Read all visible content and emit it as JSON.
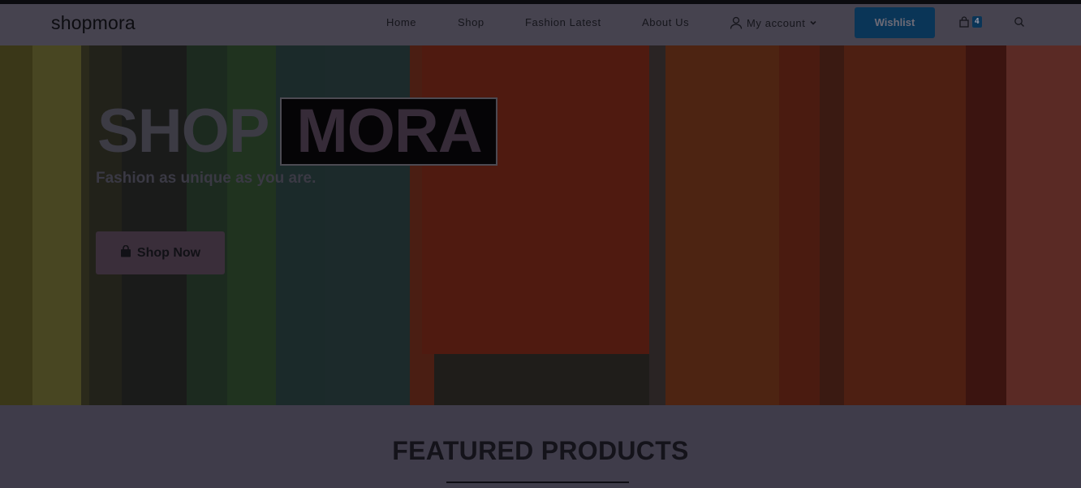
{
  "brand": {
    "logo_text": "shopmora"
  },
  "nav": {
    "home": "Home",
    "shop": "Shop",
    "latest": "Fashion Latest",
    "about": "About Us",
    "account": "My account",
    "wishlist": "Wishlist",
    "cart_count": "4"
  },
  "hero": {
    "title_part1": "SHOP",
    "title_part2": "MORA",
    "tagline": "Fashion as unique as you are.",
    "cta": "Shop Now"
  },
  "featured": {
    "title": "FEATURED PRODUCTS"
  },
  "colors": {
    "accent": "#0a3557",
    "overlay_bg": "#3f3c4a",
    "cta_bg": "#3a2e3a"
  },
  "icons": {
    "account": "user-icon",
    "account_dropdown": "chevron-down-icon",
    "cart": "shopping-bag-icon",
    "search": "search-icon",
    "cta": "shopping-bag-icon"
  }
}
